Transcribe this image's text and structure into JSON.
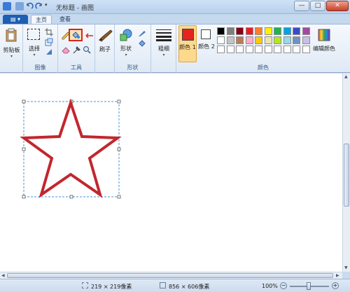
{
  "window": {
    "title": "无标题 - 画图",
    "minimize": "—",
    "maximize": "□",
    "close": "✕"
  },
  "tabs": {
    "app_menu": "▤ ▾",
    "home": "主页",
    "view": "查看"
  },
  "ribbon": {
    "clipboard": {
      "label": "剪贴板",
      "group": ""
    },
    "image": {
      "select_label": "选择",
      "group": "图像"
    },
    "tools": {
      "group": "工具"
    },
    "brushes": {
      "label": "刷子"
    },
    "shapes": {
      "shape_label": "形状",
      "group": "形状"
    },
    "size": {
      "label": "粗细"
    },
    "colors": {
      "color1": "颜色 1",
      "color2": "颜色 2",
      "edit_colors": "编辑颜色",
      "group": "颜色",
      "color1_value": "#e5231f",
      "color2_value": "#ffffff",
      "palette_row1": [
        "#000000",
        "#7f7f7f",
        "#880015",
        "#ed1c24",
        "#ff7f27",
        "#fff200",
        "#22b14c",
        "#00a2e8",
        "#3f48cc",
        "#a349a4"
      ],
      "palette_row2": [
        "#ffffff",
        "#c3c3c3",
        "#b97a57",
        "#ffaec9",
        "#ffc90e",
        "#efe4b0",
        "#b5e61d",
        "#99d9ea",
        "#7092be",
        "#c8bfe7"
      ],
      "palette_row3": [
        "#ffffff",
        "#ffffff",
        "#ffffff",
        "#ffffff",
        "#ffffff",
        "#ffffff",
        "#ffffff",
        "#ffffff",
        "#ffffff",
        "#ffffff"
      ]
    }
  },
  "canvas": {
    "star_color": "#c1272d",
    "selection_color": "#4a90d9"
  },
  "statusbar": {
    "selection_size": "219 × 219像素",
    "image_size": "856 × 606像素",
    "zoom": "100%"
  },
  "icons": [
    "save-icon",
    "undo-icon",
    "redo-icon",
    "clipboard-icon",
    "select-icon",
    "crop-icon",
    "resize-icon",
    "rotate-icon",
    "pencil-icon",
    "fill-icon",
    "text-icon",
    "eraser-icon",
    "color-picker-icon",
    "magnifier-icon",
    "brush-icon",
    "shapes-icon",
    "outline-icon",
    "fill-style-icon",
    "size-icon",
    "edit-colors-icon"
  ]
}
